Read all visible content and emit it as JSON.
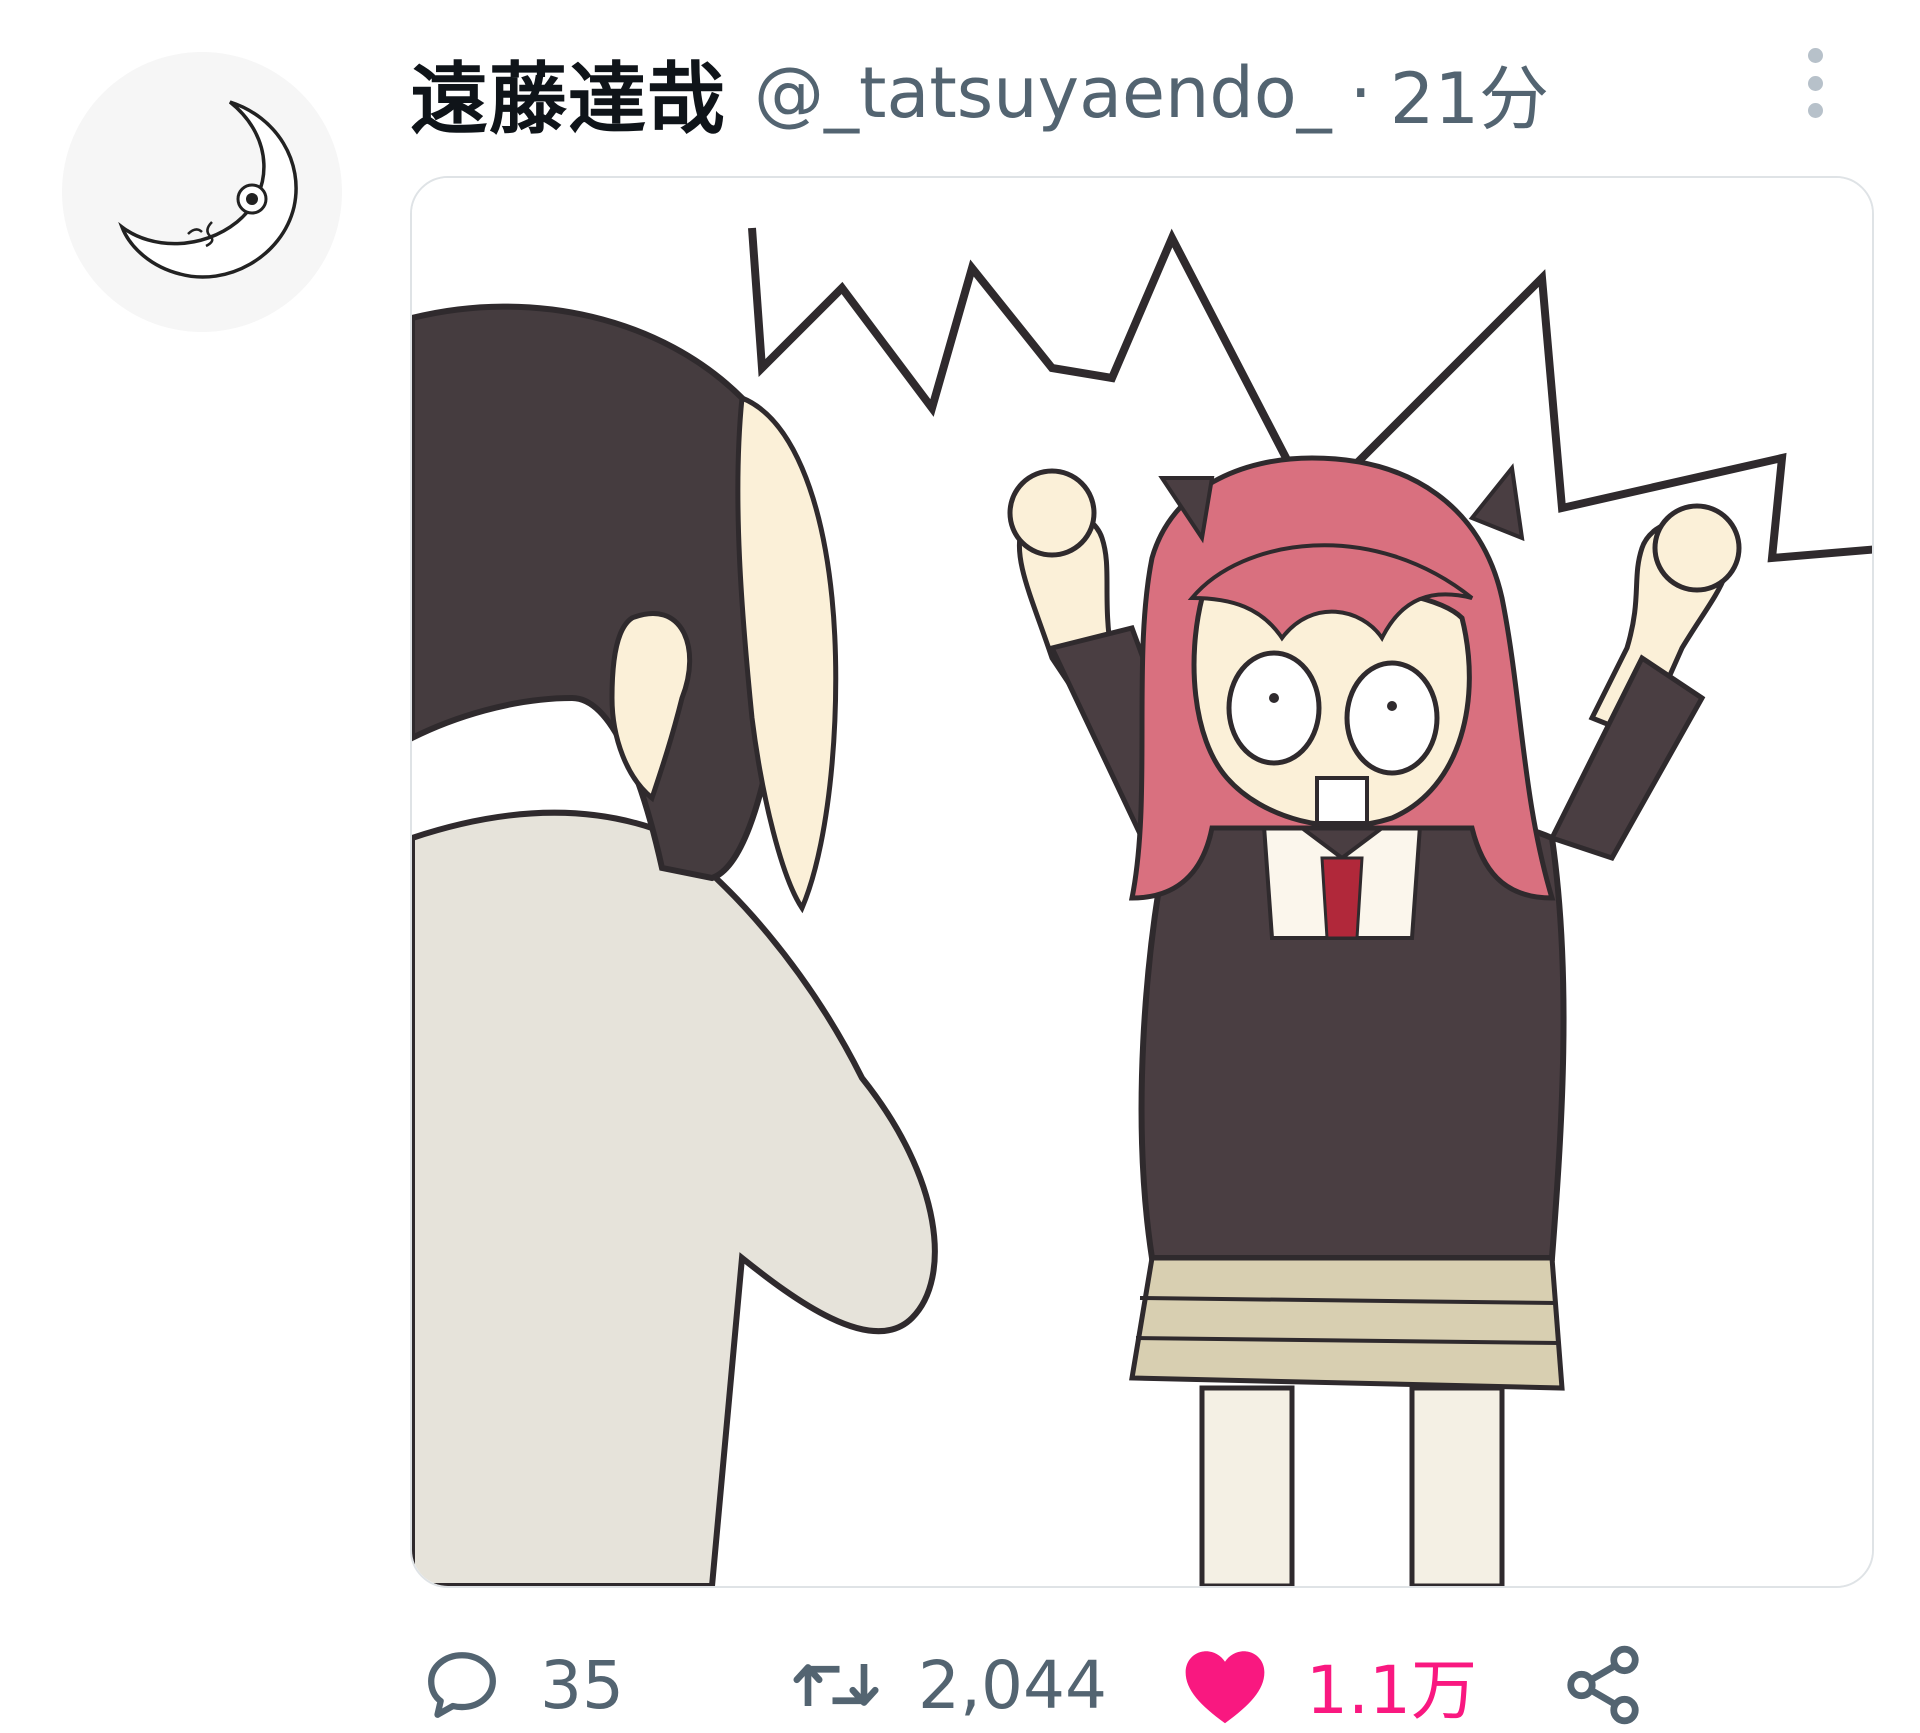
{
  "tweet": {
    "author_name": "遠藤達哉",
    "handle": "@_tatsuyaendo_",
    "separator": "·",
    "time": "21分",
    "media_description": "Illustration: a dark-haired man in a gray shirt covering his ears, and a pink-haired girl in a black uniform raising both arms and shouting"
  },
  "actions": {
    "reply_count": "35",
    "retweet_count": "2,044",
    "like_count": "1.1万",
    "liked": true
  },
  "colors": {
    "text_primary": "#0f1419",
    "text_secondary": "#536471",
    "like": "#f91880",
    "hair_girl": "#d9707f",
    "hair_man": "#453c3f",
    "uniform": "#4a3e42"
  },
  "icons": [
    "more-vertical-icon",
    "reply-icon",
    "retweet-icon",
    "heart-icon",
    "share-icon"
  ]
}
